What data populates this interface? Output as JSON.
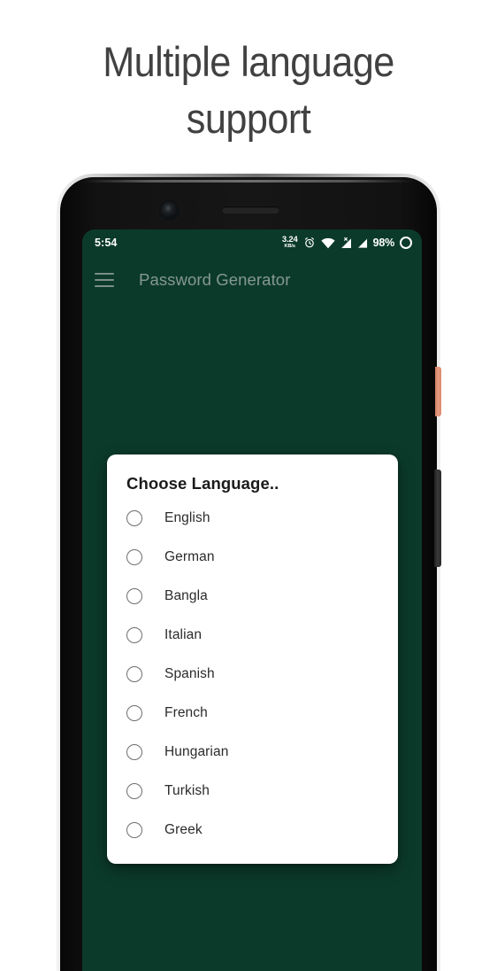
{
  "headline": "Multiple language\nsupport",
  "colors": {
    "headline_text": "#414141",
    "app_background": "#0b3a2b",
    "appbar_title": "#86988f",
    "power_button": "#e89a80",
    "dialog_background": "#ffffff",
    "page_background": "#ffffff"
  },
  "phone": {
    "status_bar": {
      "clock": "5:54",
      "network_speed_rate": "3.24",
      "network_speed_unit": "KB/s",
      "icons": [
        "alarm-icon",
        "wifi-icon",
        "signal-1-icon",
        "signal-2-icon"
      ],
      "battery_percent": "98%",
      "battery_icon": "battery-ring-icon"
    },
    "app_bar": {
      "menu_icon": "hamburger-menu-icon",
      "title": "Password Generator"
    },
    "dialog": {
      "title": "Choose Language..",
      "languages": [
        {
          "label": "English",
          "selected": false
        },
        {
          "label": "German",
          "selected": false
        },
        {
          "label": "Bangla",
          "selected": false
        },
        {
          "label": "Italian",
          "selected": false
        },
        {
          "label": "Spanish",
          "selected": false
        },
        {
          "label": "French",
          "selected": false
        },
        {
          "label": "Hungarian",
          "selected": false
        },
        {
          "label": "Turkish",
          "selected": false
        },
        {
          "label": "Greek",
          "selected": false
        }
      ]
    },
    "hardware": {
      "power_button": "power-button",
      "volume_button": "volume-rocker",
      "front_camera": "front-camera",
      "earpiece": "earpiece-speaker"
    }
  }
}
